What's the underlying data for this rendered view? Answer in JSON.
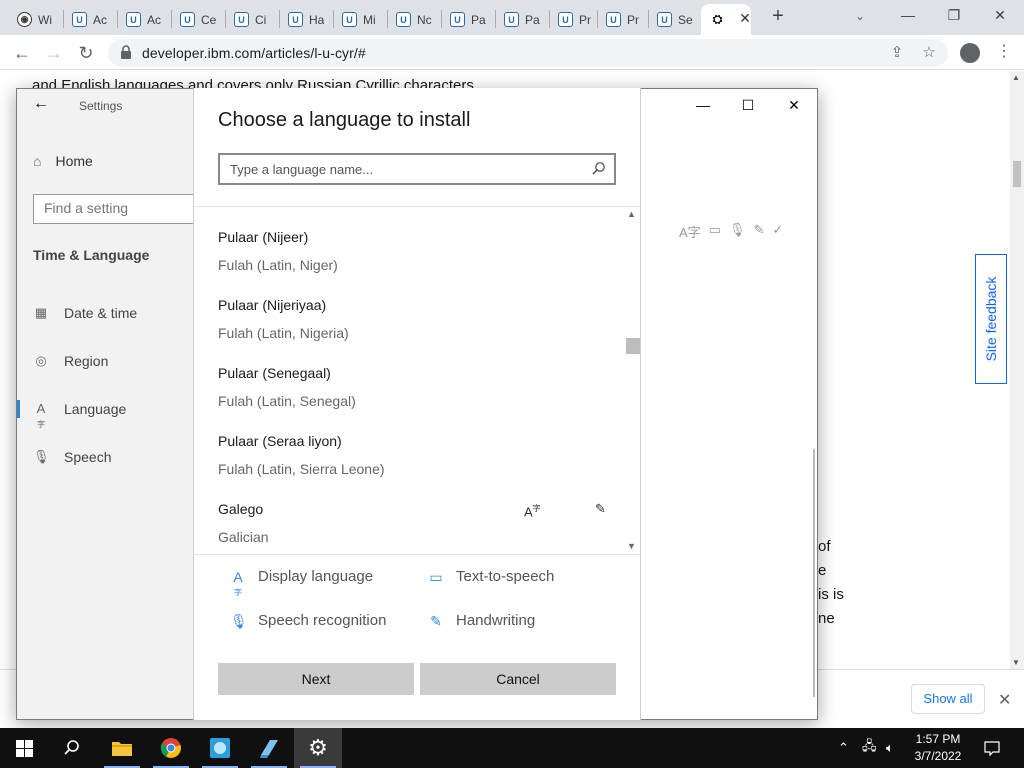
{
  "browser": {
    "tabs": [
      {
        "title": "Wi",
        "icon": "eye-icon"
      },
      {
        "title": "Ac",
        "icon": "shield-icon"
      },
      {
        "title": "Ac",
        "icon": "shield-icon"
      },
      {
        "title": "Ce",
        "icon": "shield-icon"
      },
      {
        "title": "Ci",
        "icon": "shield-icon"
      },
      {
        "title": "Ha",
        "icon": "shield-icon"
      },
      {
        "title": "Mi",
        "icon": "shield-icon"
      },
      {
        "title": "Nc",
        "icon": "shield-icon"
      },
      {
        "title": "Pa",
        "icon": "shield-icon"
      },
      {
        "title": "Pa",
        "icon": "shield-icon"
      },
      {
        "title": "Pr",
        "icon": "shield-icon"
      },
      {
        "title": "Pr",
        "icon": "shield-icon"
      },
      {
        "title": "Se",
        "icon": "shield-icon"
      }
    ],
    "url": "developer.ibm.com/articles/l-u-cyr/#"
  },
  "webpage": {
    "top_text": "and English languages and covers only Russian Cyrillic characters.",
    "right_fragments": [
      "of",
      "e",
      "is is",
      "ne"
    ],
    "site_feedback": "Site feedback",
    "show_all": "Show all"
  },
  "settings": {
    "title": "Settings",
    "home": "Home",
    "search_placeholder": "Find a setting",
    "section": "Time & Language",
    "nav": [
      {
        "label": "Date & time",
        "icon": "calendar-icon"
      },
      {
        "label": "Region",
        "icon": "globe-icon"
      },
      {
        "label": "Language",
        "icon": "language-icon"
      },
      {
        "label": "Speech",
        "icon": "microphone-icon"
      }
    ]
  },
  "dialog": {
    "title": "Choose a language to install",
    "search_placeholder": "Type a language name...",
    "languages": [
      {
        "native": "Pulaar (Nijeer)",
        "english": "Fulah (Latin, Niger)"
      },
      {
        "native": "Pulaar (Nijeriyaa)",
        "english": "Fulah (Latin, Nigeria)"
      },
      {
        "native": "Pulaar (Senegaal)",
        "english": "Fulah (Latin, Senegal)"
      },
      {
        "native": "Pulaar (Seraa liyon)",
        "english": "Fulah (Latin, Sierra Leone)"
      },
      {
        "native": "Galego",
        "english": "Galician"
      }
    ],
    "legend": {
      "display_language": "Display language",
      "text_to_speech": "Text-to-speech",
      "speech_recognition": "Speech recognition",
      "handwriting": "Handwriting"
    },
    "next": "Next",
    "cancel": "Cancel"
  },
  "taskbar": {
    "time": "1:57 PM",
    "date": "3/7/2022"
  },
  "colors": {
    "accent": "#2b88d8",
    "ibm_blue": "#0f62fe",
    "taskbar": "#101010"
  }
}
